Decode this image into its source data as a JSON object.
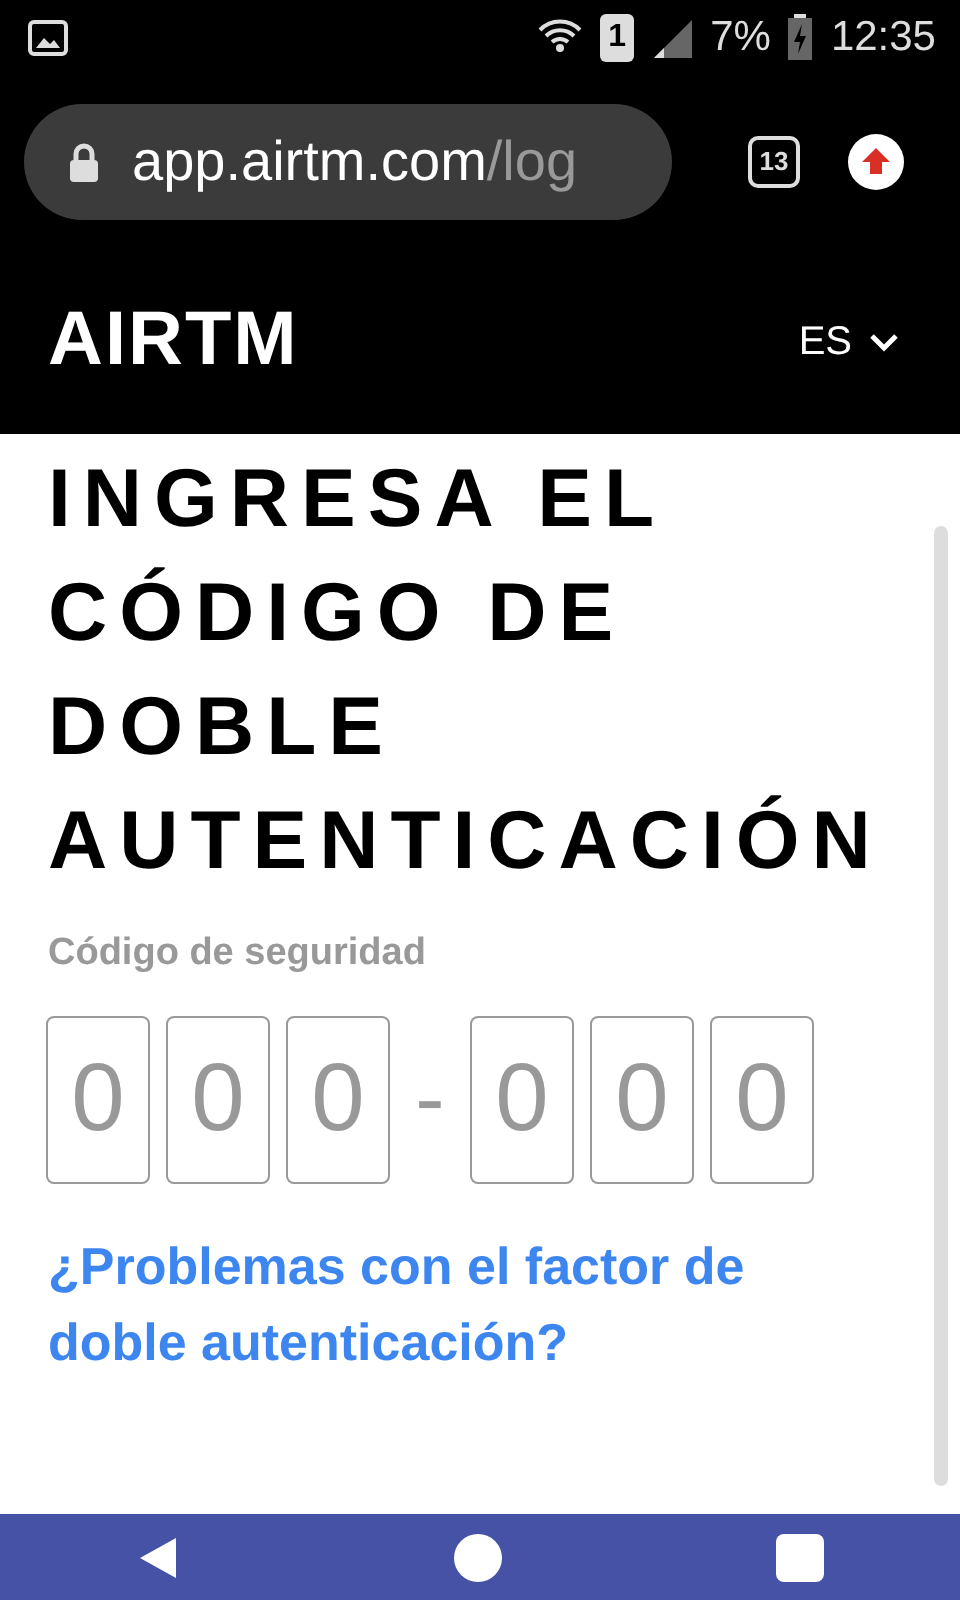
{
  "status_bar": {
    "battery": "7%",
    "time": "12:35",
    "sim_badge": "1"
  },
  "browser": {
    "url_host": "app.airtm.com",
    "url_path": "/log",
    "tab_count": "13"
  },
  "header": {
    "logo": "AIRTM",
    "language": "ES"
  },
  "title": "INGRESA EL CÓDIGO DE DOBLE AUTENTICACIÓN",
  "code": {
    "label": "Código de seguridad",
    "separator": "-",
    "boxes": [
      {
        "placeholder": "0"
      },
      {
        "placeholder": "0"
      },
      {
        "placeholder": "0"
      },
      {
        "placeholder": "0"
      },
      {
        "placeholder": "0"
      },
      {
        "placeholder": "0"
      }
    ]
  },
  "help_link": "¿Problemas con el factor de doble autenticación?"
}
